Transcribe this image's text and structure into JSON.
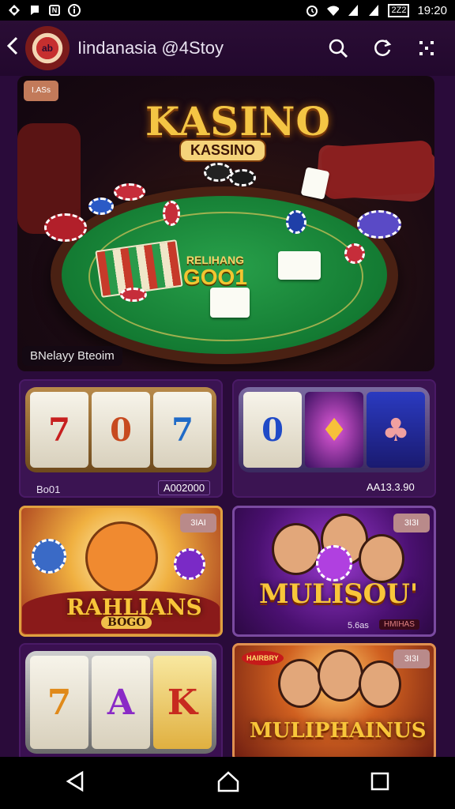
{
  "status_bar": {
    "time": "19:20",
    "left_icons": [
      "app-icon",
      "notification-icon",
      "n-box-icon",
      "info-icon"
    ],
    "right_icons": [
      "alarm-icon",
      "wifi-icon",
      "signal-icon",
      "signal-icon",
      "battery-icon"
    ],
    "battery_text": "2Z2"
  },
  "app_bar": {
    "title": "Iindanasia @4Stoy",
    "avatar_text": "ab",
    "actions": [
      "search-icon",
      "refresh-icon",
      "more-icon"
    ]
  },
  "hero": {
    "badge": "I.ASs",
    "logo": "KASINO",
    "logo_sub": "KASSINO",
    "felt_small": "RELIHANG",
    "felt_big": "GOO1",
    "caption": "BNelayy Bteoim"
  },
  "tiles": [
    {
      "id": "slot-left",
      "reels": [
        "7",
        "0",
        "7"
      ],
      "label": "Bo01",
      "price": "A002000"
    },
    {
      "id": "slot-right",
      "reels": [
        "0",
        "♦",
        "♣"
      ],
      "label": "",
      "price": "AA13.3.90"
    },
    {
      "id": "cat-game",
      "title": "RAHLIANS",
      "subtitle": "BOGO",
      "badge": "3IAI"
    },
    {
      "id": "party-game",
      "title": "MULISOU'",
      "badge": "3I3I",
      "foot_left": "5.6as",
      "foot_right": "HMIHAS"
    },
    {
      "id": "slot-bottom",
      "reels": [
        "7",
        "A",
        "K"
      ]
    },
    {
      "id": "people-game",
      "title": "MULIPHAINUS",
      "badge": "3I3I",
      "ribbon": "HAIRBRY"
    }
  ],
  "colors": {
    "background": "#2a0b3a",
    "gold": "#f4c544",
    "felt_green": "#137a32"
  },
  "nav": [
    "back-icon",
    "home-icon",
    "recents-icon"
  ]
}
